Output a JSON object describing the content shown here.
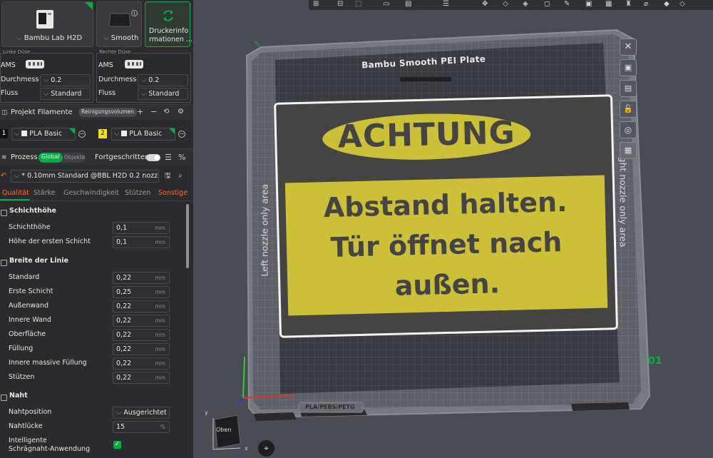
{
  "printer": {
    "name": "Bambu Lab H2D",
    "plate_type": "Smooth",
    "info_button": "Druckerinformationen ...",
    "info_line1": "Druckerinfo",
    "info_line2": "rmationen ..."
  },
  "nozzles": {
    "left": {
      "title": "Linke Düse",
      "ams": "AMS",
      "diameter_label": "Durchmesser",
      "diameter": "0.2",
      "flow_label": "Fluss",
      "flow": "Standard"
    },
    "right": {
      "title": "Rechte Düse",
      "ams": "AMS",
      "diameter_label": "Durchmesser",
      "diameter": "0.2",
      "flow_label": "Fluss",
      "flow": "Standard"
    }
  },
  "filaments": {
    "title": "Projekt Filamente",
    "purge_button": "Reinigungsvolumen",
    "items": [
      {
        "num": "1",
        "name": "PLA Basic",
        "color": "#111111",
        "numcolor": "#ffffff"
      },
      {
        "num": "2",
        "name": "PLA Basic",
        "color": "#f2e600",
        "numcolor": "#111111"
      }
    ]
  },
  "process": {
    "title": "Prozess",
    "toggle_global": "Global",
    "toggle_objects": "Objekte",
    "advanced_label": "Fortgeschritten",
    "preset": "* 0.10mm Standard @BBL H2D 0.2 nozz..."
  },
  "tabs": [
    {
      "label": "Qualität",
      "active": true
    },
    {
      "label": "Stärke",
      "active": false
    },
    {
      "label": "Geschwindigkeit",
      "active": false
    },
    {
      "label": "Stützen",
      "active": false
    },
    {
      "label": "Sonstige",
      "active": false
    }
  ],
  "sections": {
    "layer_height": {
      "title": "Schichthöhe",
      "rows": [
        {
          "label": "Schichthöhe",
          "value": "0,1",
          "unit": "mm"
        },
        {
          "label": "Höhe der ersten Schicht",
          "value": "0,1",
          "unit": "mm"
        }
      ]
    },
    "line_width": {
      "title": "Breite der Linie",
      "rows": [
        {
          "label": "Standard",
          "value": "0,22",
          "unit": "mm"
        },
        {
          "label": "Erste Schicht",
          "value": "0,25",
          "unit": "mm"
        },
        {
          "label": "Außenwand",
          "value": "0,22",
          "unit": "mm"
        },
        {
          "label": "Innere Wand",
          "value": "0,22",
          "unit": "mm"
        },
        {
          "label": "Oberfläche",
          "value": "0,22",
          "unit": "mm"
        },
        {
          "label": "Füllung",
          "value": "0,22",
          "unit": "mm"
        },
        {
          "label": "Innere massive Füllung",
          "value": "0,22",
          "unit": "mm"
        },
        {
          "label": "Stützen",
          "value": "0,22",
          "unit": "mm"
        }
      ]
    },
    "seam": {
      "title": "Naht",
      "position_label": "Nahtposition",
      "position_value": "Ausgerichtet",
      "gap_label": "Nahtlücke",
      "gap_value": "15",
      "gap_unit": "%",
      "scarf_label_1": "Intelligente",
      "scarf_label_2": "Schrägnaht-Anwendung",
      "scarf_checked": true
    }
  },
  "viewport": {
    "plate_name": "Bambu Smooth PEI Plate",
    "left_area": "Left nozzle only area",
    "right_area": "Right nozzle only area",
    "plate_number": "01",
    "plate_material": "PLA/PEBS/PETG",
    "cube_face": "Oben",
    "axis_x": "x",
    "axis_y": "y"
  },
  "sign": {
    "heading": "ACHTUNG",
    "line1": "Abstand halten.",
    "line2": "Tür öffnet nach",
    "line3": "außen."
  },
  "colors": {
    "accent": "#00ae42",
    "orange": "#ff6b2c",
    "sign_yellow": "#cbc037",
    "sign_dark": "#444444"
  }
}
